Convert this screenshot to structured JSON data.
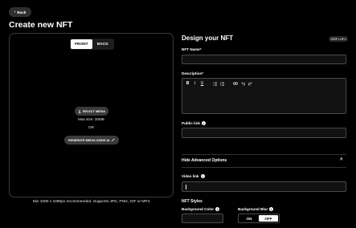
{
  "header": {
    "back_label": "Back",
    "title": "Create new NFT"
  },
  "preview": {
    "tabs": [
      {
        "label": "FRONT",
        "active": true
      },
      {
        "label": "BACK",
        "active": false
      }
    ],
    "select_media_label": "SELECT MEDIA",
    "max_size": "Max size: 20MB",
    "or_text": "OR",
    "generate_ai_label": "GENERATE MEDIA USING AI",
    "hint": "Min 1080 x 1080px recommended. Supports JPG, PNG, GIF or MP4"
  },
  "design": {
    "title": "Design your NFT",
    "step": "STEP 1 OF 2",
    "nft_name_label": "NFT Name*",
    "nft_name_value": "",
    "description_label": "Description*",
    "description_value": "",
    "editor_tools": [
      "bold",
      "italic",
      "underline",
      "ordered-list",
      "unordered-list",
      "link",
      "undo",
      "redo"
    ],
    "public_link_label": "Public link",
    "public_link_value": "",
    "advanced_toggle_label": "Hide Advanced Options",
    "video_link_label": "Video link",
    "video_link_value": "",
    "styles_title": "NFT Styles",
    "background_color_label": "Background Color",
    "background_color_value": "",
    "background_blur_label": "Background Blur",
    "blur_options": [
      {
        "label": "ON",
        "active": false
      },
      {
        "label": "OFF",
        "active": true
      }
    ]
  }
}
